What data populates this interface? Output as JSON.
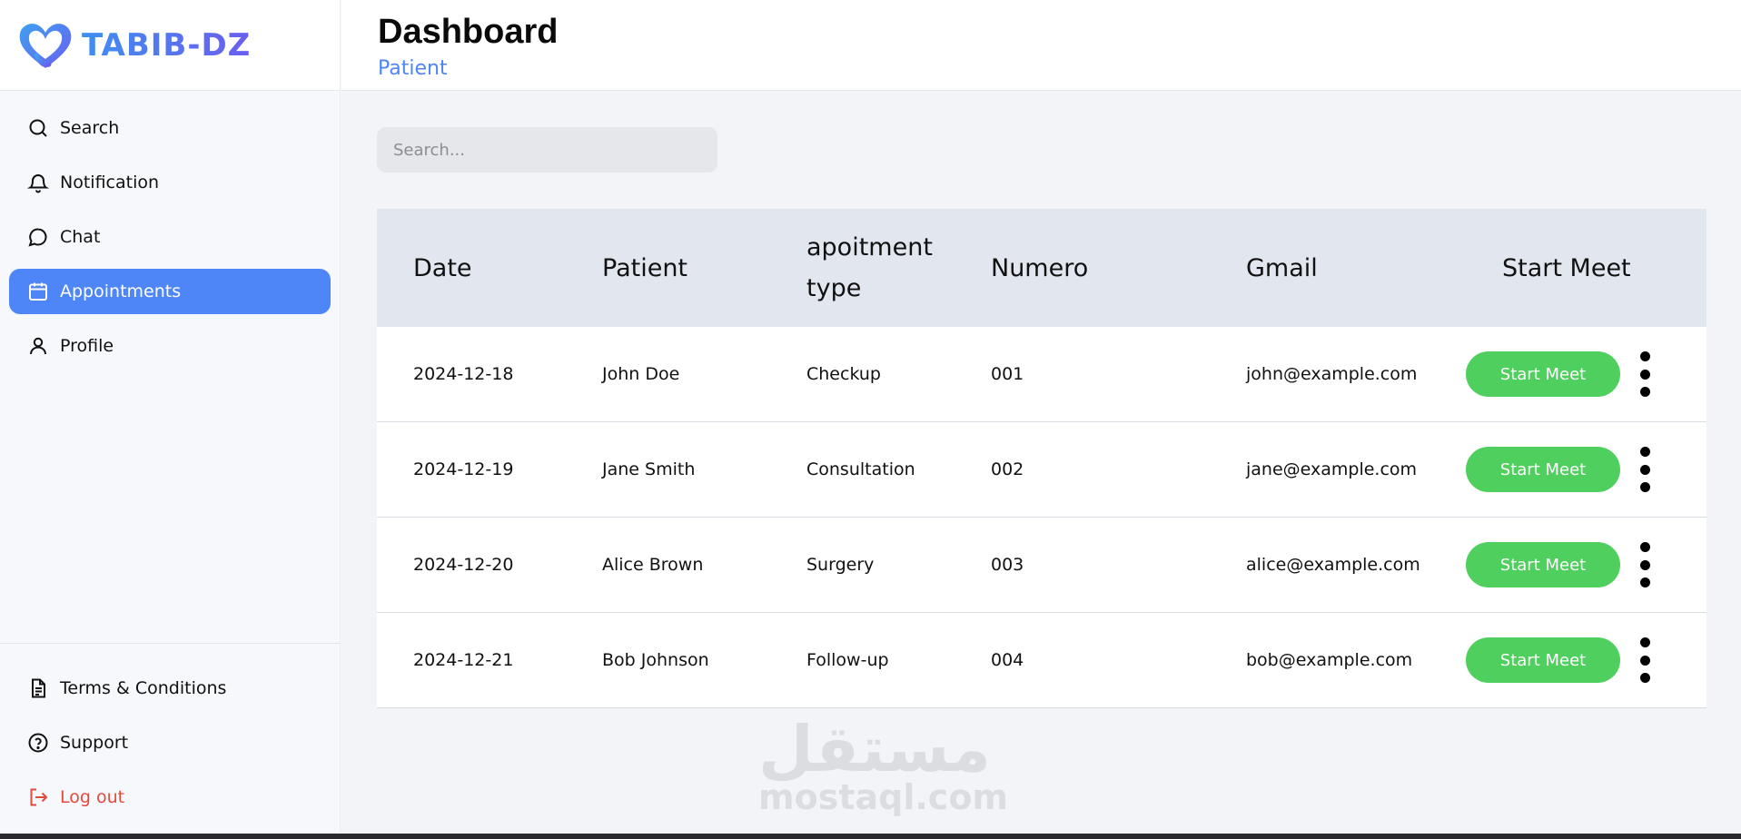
{
  "app": {
    "brand": "TABIB-DZ",
    "accent": "#4f86f7",
    "success": "#4fcf5d",
    "danger": "#e04b3c"
  },
  "sidebar": {
    "items": [
      {
        "label": "Search",
        "icon": "search-icon"
      },
      {
        "label": "Notification",
        "icon": "bell-icon"
      },
      {
        "label": "Chat",
        "icon": "chat-icon"
      },
      {
        "label": "Appointments",
        "icon": "calendar-icon",
        "active": true
      },
      {
        "label": "Profile",
        "icon": "user-icon"
      }
    ],
    "bottom": [
      {
        "label": "Terms & Conditions",
        "icon": "document-icon"
      },
      {
        "label": "Support",
        "icon": "help-icon"
      },
      {
        "label": "Log out",
        "icon": "logout-icon"
      }
    ]
  },
  "header": {
    "title": "Dashboard",
    "subtitle": "Patient"
  },
  "search": {
    "placeholder": "Search...",
    "value": ""
  },
  "table": {
    "columns": [
      "Date",
      "Patient",
      "apoitment type",
      "Numero",
      "Gmail",
      "Start Meet"
    ],
    "rows": [
      {
        "date": "2024-12-18",
        "patient": "John Doe",
        "type": "Checkup",
        "numero": "001",
        "gmail": "john@example.com",
        "action": "Start Meet"
      },
      {
        "date": "2024-12-19",
        "patient": "Jane Smith",
        "type": "Consultation",
        "numero": "002",
        "gmail": "jane@example.com",
        "action": "Start Meet"
      },
      {
        "date": "2024-12-20",
        "patient": "Alice Brown",
        "type": "Surgery",
        "numero": "003",
        "gmail": "alice@example.com",
        "action": "Start Meet"
      },
      {
        "date": "2024-12-21",
        "patient": "Bob Johnson",
        "type": "Follow-up",
        "numero": "004",
        "gmail": "bob@example.com",
        "action": "Start Meet"
      }
    ]
  },
  "watermark": {
    "arabic": "مستقل",
    "latin": "mostaql.com"
  }
}
